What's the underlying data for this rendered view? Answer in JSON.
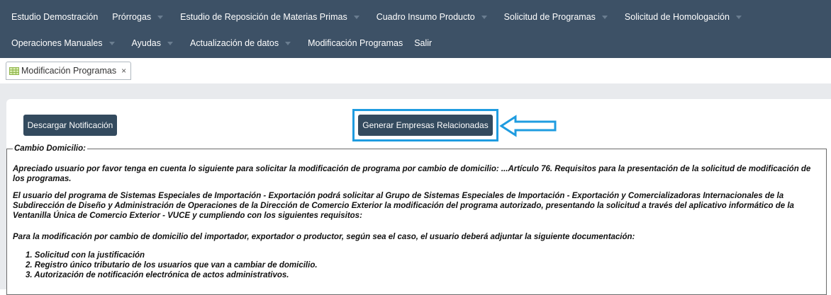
{
  "nav": {
    "row1": [
      {
        "label": "Estudio Demostración",
        "caret": false
      },
      {
        "label": "Prórrogas",
        "caret": true
      },
      {
        "label": "Estudio de Reposición de Materias Primas",
        "caret": true
      },
      {
        "label": "Cuadro Insumo Producto",
        "caret": true
      },
      {
        "label": "Solicitud de Programas",
        "caret": true
      },
      {
        "label": "Solicitud de Homologación",
        "caret": true
      }
    ],
    "row2": [
      {
        "label": "Operaciones Manuales",
        "caret": true
      },
      {
        "label": "Ayudas",
        "caret": true
      },
      {
        "label": "Actualización de datos",
        "caret": true
      },
      {
        "label": "Modificación Programas",
        "caret": false
      },
      {
        "label": "Salir",
        "caret": false
      }
    ]
  },
  "tab": {
    "label": "Modificación Programas",
    "close": "×"
  },
  "buttons": {
    "download": "Descargar Notificación",
    "generate": "Generar Empresas Relacionadas"
  },
  "notice": {
    "legend": "Cambio Domicilio:",
    "p1": "Apreciado usuario por favor tenga en cuenta lo siguiente para solicitar la modificación de programa por cambio de domicilio: ...Artículo 76. Requisitos para la presentación de la solicitud de modificación de los programas.",
    "p2": "El usuario del programa de Sistemas Especiales de Importación - Exportación podrá solicitar al Grupo de Sistemas Especiales de Importación - Exportación y Comercializadoras Internacionales de la Subdirección de Diseño y Administración de Operaciones de la Dirección de Comercio Exterior la modificación del programa autorizado, presentando la solicitud a través del aplicativo informático de la Ventanilla Única de Comercio Exterior - VUCE y cumpliendo con los siguientes requisitos:",
    "p3": "Para la modificación por cambio de domicilio del importador, exportador o productor, según sea el caso, el usuario deberá adjuntar la siguiente documentación:",
    "items": [
      "1. Solicitud con la justificación",
      "2. Registro único tributario de los usuarios que van a cambiar de domicilio.",
      "3. Autorización de notificación electrónica de actos administrativos."
    ]
  },
  "colors": {
    "navbar": "#3d5166",
    "button": "#334a5e",
    "highlight": "#1f9ce0",
    "content_bg": "#e8eaed"
  },
  "icons": {
    "tab": "table-icon",
    "close": "close-icon",
    "arrow": "left-arrow-icon",
    "caret": "caret-down-icon"
  }
}
